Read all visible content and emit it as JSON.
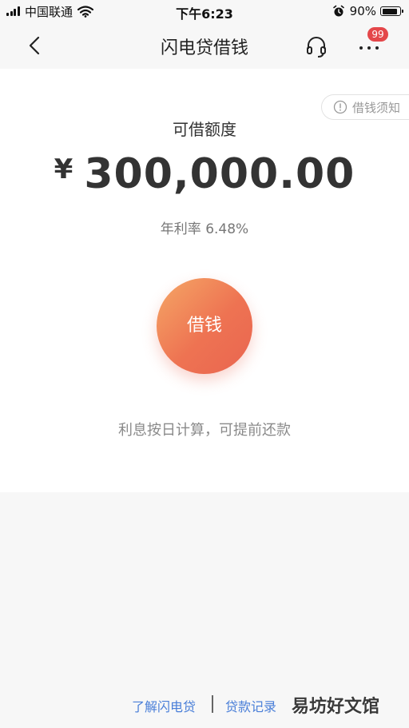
{
  "status_bar": {
    "carrier": "中国联通",
    "time": "下午6:23",
    "battery_percent": "90%",
    "battery_level": 0.9
  },
  "nav": {
    "title": "闪电贷借钱",
    "badge_count": "99",
    "icons": {
      "back": "chevron-left-icon",
      "customer_service": "headset-icon",
      "more": "more-dots-icon"
    }
  },
  "loan": {
    "notice_label": "借钱须知",
    "limit_label": "可借额度",
    "currency_symbol": "¥",
    "amount": "300,000.00",
    "rate_label": "年利率",
    "rate_value": "6.48%",
    "borrow_button": "借钱",
    "interest_note": "利息按日计算，可提前还款"
  },
  "footer": {
    "about_link": "了解闪电贷",
    "records_link": "贷款记录",
    "watermark": "易坊好文馆"
  },
  "colors": {
    "accent_start": "#f5a766",
    "accent_end": "#e96550",
    "link": "#4a7fd8",
    "badge": "#e4474a"
  }
}
